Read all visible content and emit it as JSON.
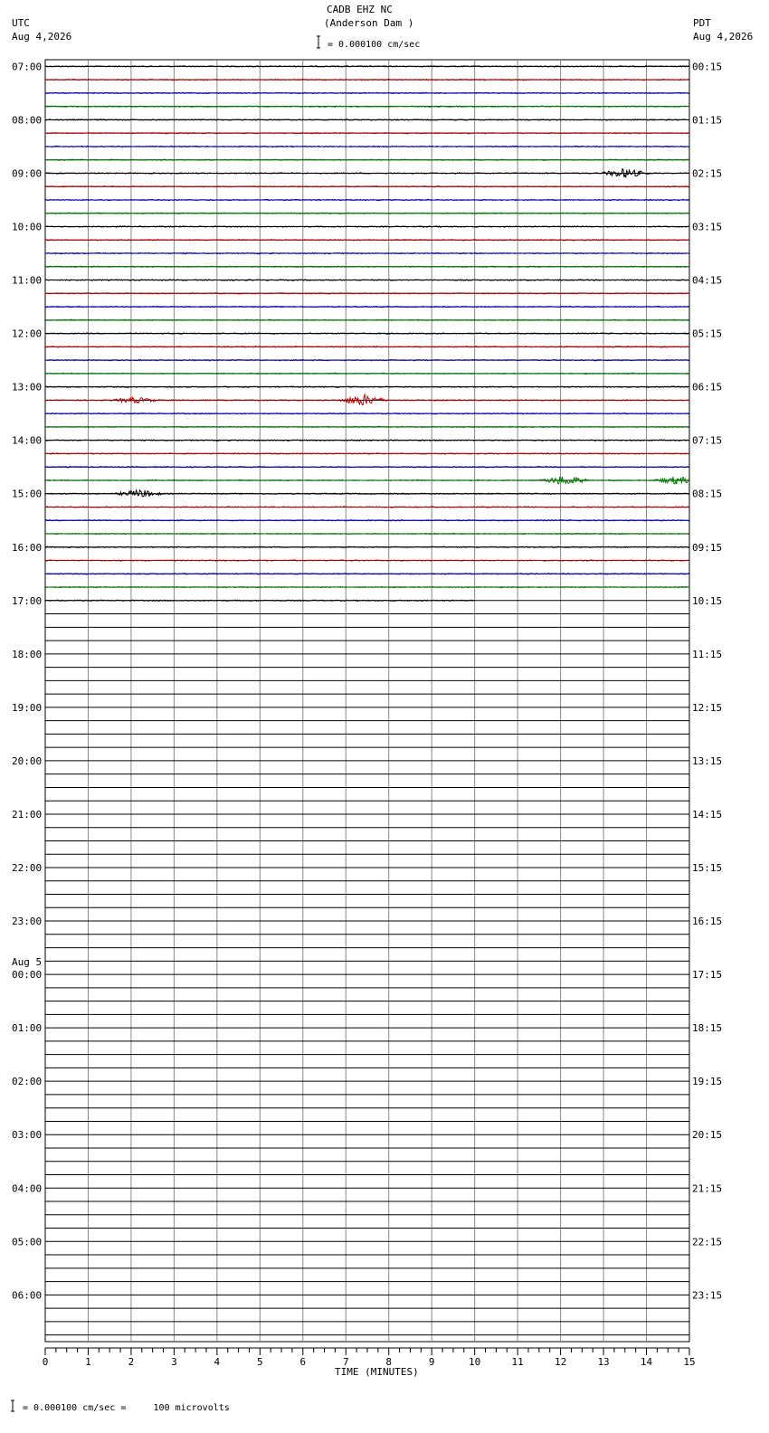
{
  "header": {
    "station_line": "CADB EHZ NC",
    "location_line": "(Anderson Dam )",
    "scale_label": "= 0.000100 cm/sec",
    "left_tz": "UTC",
    "left_date": "Aug 4,2026",
    "right_tz": "PDT",
    "right_date": "Aug 4,2026"
  },
  "footer": {
    "scale_note": "= 0.000100 cm/sec =     100 microvolts"
  },
  "chart_data": {
    "type": "line",
    "xlabel": "TIME (MINUTES)",
    "xlim": [
      0,
      15
    ],
    "x_ticks": [
      "0",
      "1",
      "2",
      "3",
      "4",
      "5",
      "6",
      "7",
      "8",
      "9",
      "10",
      "11",
      "12",
      "13",
      "14",
      "15"
    ],
    "trace_minutes_per_line": 15,
    "traces_per_hour": 4,
    "total_traces": 96,
    "recorded_traces": 41,
    "last_trace_end_minute": 10,
    "trace_colors": [
      "#000000",
      "#c00000",
      "#0000c0",
      "#008000"
    ],
    "utc_labels": [
      {
        "hour_index": 0,
        "label": "07:00"
      },
      {
        "hour_index": 1,
        "label": "08:00"
      },
      {
        "hour_index": 2,
        "label": "09:00"
      },
      {
        "hour_index": 3,
        "label": "10:00"
      },
      {
        "hour_index": 4,
        "label": "11:00"
      },
      {
        "hour_index": 5,
        "label": "12:00"
      },
      {
        "hour_index": 6,
        "label": "13:00"
      },
      {
        "hour_index": 7,
        "label": "14:00"
      },
      {
        "hour_index": 8,
        "label": "15:00"
      },
      {
        "hour_index": 9,
        "label": "16:00"
      },
      {
        "hour_index": 10,
        "label": "17:00"
      },
      {
        "hour_index": 11,
        "label": "18:00"
      },
      {
        "hour_index": 12,
        "label": "19:00"
      },
      {
        "hour_index": 13,
        "label": "20:00"
      },
      {
        "hour_index": 14,
        "label": "21:00"
      },
      {
        "hour_index": 15,
        "label": "22:00"
      },
      {
        "hour_index": 16,
        "label": "23:00"
      },
      {
        "hour_index": 17,
        "label": "00:00",
        "date": "Aug 5"
      },
      {
        "hour_index": 18,
        "label": "01:00"
      },
      {
        "hour_index": 19,
        "label": "02:00"
      },
      {
        "hour_index": 20,
        "label": "03:00"
      },
      {
        "hour_index": 21,
        "label": "04:00"
      },
      {
        "hour_index": 22,
        "label": "05:00"
      },
      {
        "hour_index": 23,
        "label": "06:00"
      }
    ],
    "pdt_labels": [
      "00:15",
      "01:15",
      "02:15",
      "03:15",
      "04:15",
      "05:15",
      "06:15",
      "07:15",
      "08:15",
      "09:15",
      "10:15",
      "11:15",
      "12:15",
      "13:15",
      "14:15",
      "15:15",
      "16:15",
      "17:15",
      "18:15",
      "19:15",
      "20:15",
      "21:15",
      "22:15",
      "23:15"
    ],
    "events": [
      {
        "trace": 8,
        "minute": 13.5,
        "amplitude": 5
      },
      {
        "trace": 25,
        "minute": 7.4,
        "amplitude": 6
      },
      {
        "trace": 25,
        "minute": 2.1,
        "amplitude": 3
      },
      {
        "trace": 31,
        "minute": 12.1,
        "amplitude": 5
      },
      {
        "trace": 31,
        "minute": 14.7,
        "amplitude": 4
      },
      {
        "trace": 32,
        "minute": 2.2,
        "amplitude": 4
      }
    ]
  }
}
